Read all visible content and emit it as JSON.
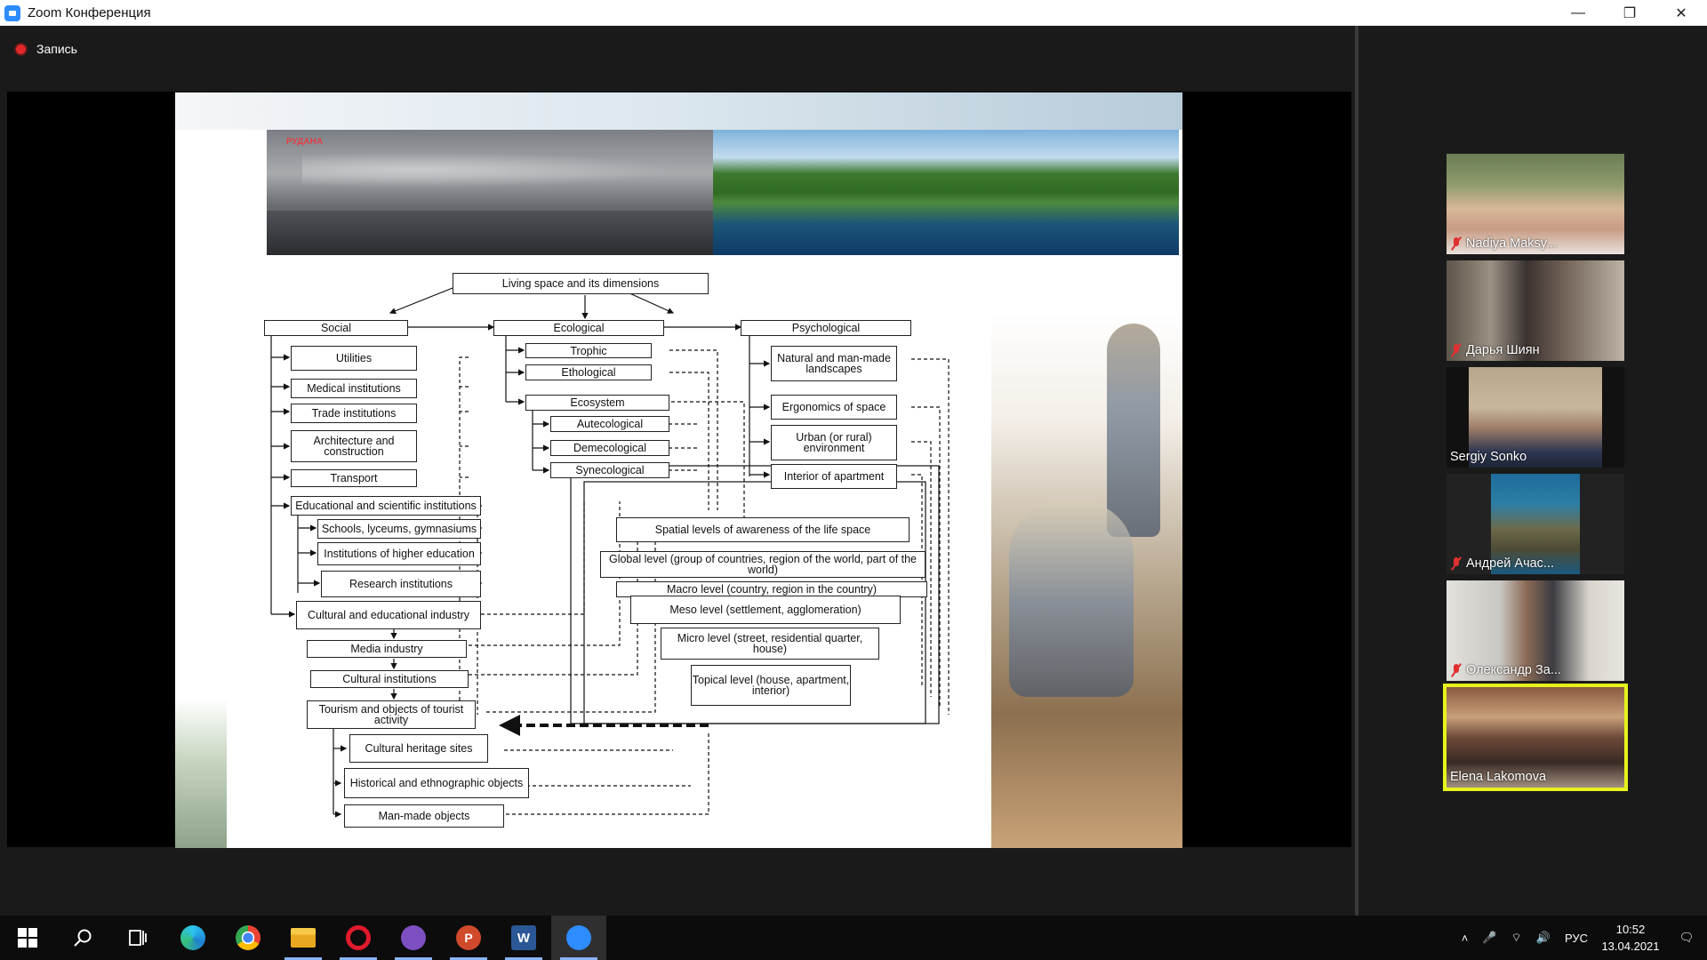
{
  "window": {
    "title": "Zoom Конференция",
    "minimize": "—",
    "restore": "❐",
    "close": "✕",
    "icon": "zoom-camera-icon"
  },
  "recording": {
    "label": "Запись"
  },
  "slide": {
    "photo_logo": "РУДАНА",
    "diagram": {
      "root": "Living space and its dimensions",
      "social": "Social",
      "ecological": "Ecological",
      "psychological": "Psychological",
      "social_items": [
        "Utilities",
        "Medical institutions",
        "Trade institutions",
        "Architecture and construction",
        "Transport",
        "Educational and scientific institutions",
        "Schools, lyceums, gymnasiums",
        "Institutions of higher education",
        "Research institutions",
        "Cultural and educational industry",
        "Media industry",
        "Cultural institutions",
        "Tourism and objects of tourist activity",
        "Cultural heritage sites",
        "Historical and ethnographic objects",
        "Man-made objects"
      ],
      "eco_items": [
        "Trophic",
        "Ethological",
        "Ecosystem",
        "Autecological",
        "Demecological",
        "Synecological"
      ],
      "psy_items": [
        "Natural and man-made landscapes",
        "Ergonomics of space",
        "Urban (or rural) environment",
        "Interior of apartment"
      ],
      "levels": [
        "Spatial levels of awareness of the life space",
        "Global level (group of countries, region of the world, part of the world)",
        "Macro level (country, region in the country)",
        "Meso level (settlement, agglomeration)",
        "Micro level (street, residential quarter, house)",
        "Topical level (house, apartment, interior)"
      ]
    }
  },
  "participants": [
    {
      "name": "Nadiya Maksy...",
      "muted": true
    },
    {
      "name": "Дарья Шиян",
      "muted": true
    },
    {
      "name": "Sergiy Sonko",
      "muted": false
    },
    {
      "name": "Андрей Ачас...",
      "muted": true
    },
    {
      "name": "Олександр За...",
      "muted": true
    },
    {
      "name": "Elena Lakomova",
      "muted": false,
      "active": true
    }
  ],
  "taskbar": {
    "apps": [
      "windows-start-icon",
      "search-icon",
      "task-view-icon",
      "edge-icon",
      "chrome-icon",
      "file-explorer-icon",
      "opera-icon",
      "viber-icon",
      "powerpoint-icon",
      "word-icon",
      "zoom-icon"
    ],
    "language": "РУС",
    "time": "10:52",
    "date": "13.04.2021"
  },
  "colors": {
    "active_speaker": "#e6f21c",
    "muted": "#e03030",
    "zoom_blue": "#2d8cff"
  }
}
